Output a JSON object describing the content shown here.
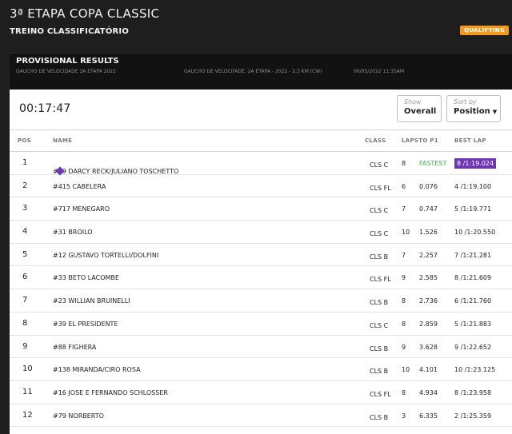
{
  "event": {
    "title": "3ª ETAPA COPA CLASSIC",
    "session": "TREINO CLASSIFICATÓRIO",
    "badge": "QUALIFYING"
  },
  "results": {
    "title": "PROVISIONAL RESULTS",
    "meta_1": "GAUCHO DE VELOCIDADE 2A ETAPA 2022",
    "meta_2": "GAUCHO DE VELOCIFADE, 2A ETAPA - 2022 - 2,3 KM (CW)",
    "meta_3": "06/05/2022 11:35AM"
  },
  "clock": "00:17:47",
  "controls": {
    "show_label": "Show",
    "show_value": "Overall",
    "sort_label": "Sort by",
    "sort_value": "Position"
  },
  "columns": {
    "pos": "POS",
    "name": "NAME",
    "class": "CLASS",
    "laps_p1": "LAPSTO P1",
    "best_lap": "BEST LAP"
  },
  "rows": [
    {
      "pos": "1",
      "name": "#19 DARCY RECK/JULIANO TOSCHETTO",
      "class": "CLS C",
      "laps": "8",
      "gap": "FASTEST",
      "best": "8 /1:19.024"
    },
    {
      "pos": "2",
      "name": "#415 CABELERA",
      "class": "CLS FL",
      "laps": "6",
      "gap": "0.076",
      "best": "4 /1:19.100"
    },
    {
      "pos": "3",
      "name": "#717 MENEGARO",
      "class": "CLS C",
      "laps": "7",
      "gap": "0.747",
      "best": "5 /1:19.771"
    },
    {
      "pos": "4",
      "name": "#31 BROILO",
      "class": "CLS C",
      "laps": "10",
      "gap": "1.526",
      "best": "10 /1:20.550"
    },
    {
      "pos": "5",
      "name": "#12 GUSTAVO TORTELLI/DOLFINI",
      "class": "CLS B",
      "laps": "7",
      "gap": "2.257",
      "best": "7 /1:21.281"
    },
    {
      "pos": "6",
      "name": "#33 BETO LACOMBE",
      "class": "CLS FL",
      "laps": "9",
      "gap": "2.585",
      "best": "8 /1:21.609"
    },
    {
      "pos": "7",
      "name": "#23 WILLIAN BRUINELLI",
      "class": "CLS B",
      "laps": "8",
      "gap": "2.736",
      "best": "6 /1:21.760"
    },
    {
      "pos": "8",
      "name": "#39 EL PRESIDENTE",
      "class": "CLS C",
      "laps": "8",
      "gap": "2.859",
      "best": "5 /1:21.883"
    },
    {
      "pos": "9",
      "name": "#88 FIGHERA",
      "class": "CLS B",
      "laps": "9",
      "gap": "3.628",
      "best": "9 /1:22.652"
    },
    {
      "pos": "10",
      "name": "#138 MIRANDA/CIRO ROSA",
      "class": "CLS B",
      "laps": "10",
      "gap": "4.101",
      "best": "10 /1:23.125"
    },
    {
      "pos": "11",
      "name": "#16 JOSE E FERNANDO SCHLOSSER",
      "class": "CLS FL",
      "laps": "8",
      "gap": "4.934",
      "best": "8 /1:23.958"
    },
    {
      "pos": "12",
      "name": "#79 NORBERTO",
      "class": "CLS B",
      "laps": "3",
      "gap": "6.335",
      "best": "2 /1:25.359"
    }
  ],
  "colors": {
    "fastest_gap": "#39b54a",
    "best_lap_highlight": "#6e35b5",
    "badge": "#f39a1e"
  },
  "icons": {
    "row_1_marker": "purple-diamond-icon",
    "sort_caret": "caret-down-icon"
  }
}
